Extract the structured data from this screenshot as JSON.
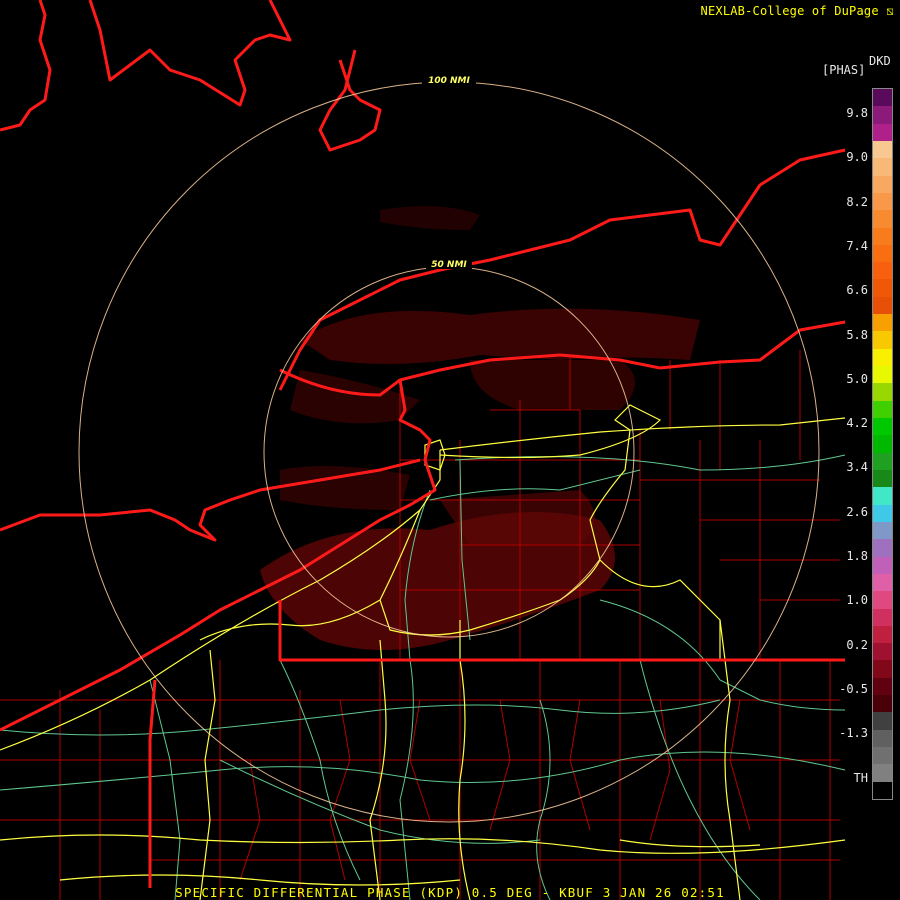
{
  "header": {
    "credit": "NEXLAB-College of DuPage ⧅"
  },
  "legend": {
    "product": "DKD",
    "units": "[PHAS]",
    "ticks": [
      "9.8",
      "9.0",
      "8.2",
      "7.4",
      "6.6",
      "5.8",
      "5.0",
      "4.2",
      "3.4",
      "2.6",
      "1.8",
      "1.0",
      "0.2",
      "-0.5",
      "-1.3",
      "TH"
    ],
    "colors": [
      "#5a0a5a",
      "#8b1a7a",
      "#b0208a",
      "#f8c890",
      "#f8b878",
      "#f8a860",
      "#f89848",
      "#f88a30",
      "#f87c1c",
      "#f86e10",
      "#f86010",
      "#f05808",
      "#e85008",
      "#f8a000",
      "#f8c800",
      "#f8f000",
      "#e8f800",
      "#98d800",
      "#40d000",
      "#00c800",
      "#00b800",
      "#20a020",
      "#188818",
      "#40e8c8",
      "#40c8e8",
      "#8098c8",
      "#a070c0",
      "#c060b8",
      "#e060a8",
      "#e04880",
      "#d03060",
      "#c02040",
      "#a01030",
      "#800818",
      "#600010",
      "#4a0008",
      "#404040",
      "#606060",
      "#707070",
      "#808080",
      "#000000"
    ]
  },
  "rings": {
    "inner_label": "50 NMI",
    "outer_label": "100 NMI"
  },
  "caption": "SPECIFIC DIFFERENTIAL PHASE (KDP) 0.5 DEG - KBUF 3 JAN 26 02:51",
  "colors": {
    "state_border": "#ff1a1a",
    "county": "#b00000",
    "interstate": "#ffff40",
    "highway": "#60c890",
    "ring": "#ffd0a0",
    "echo": "#6a0606"
  }
}
